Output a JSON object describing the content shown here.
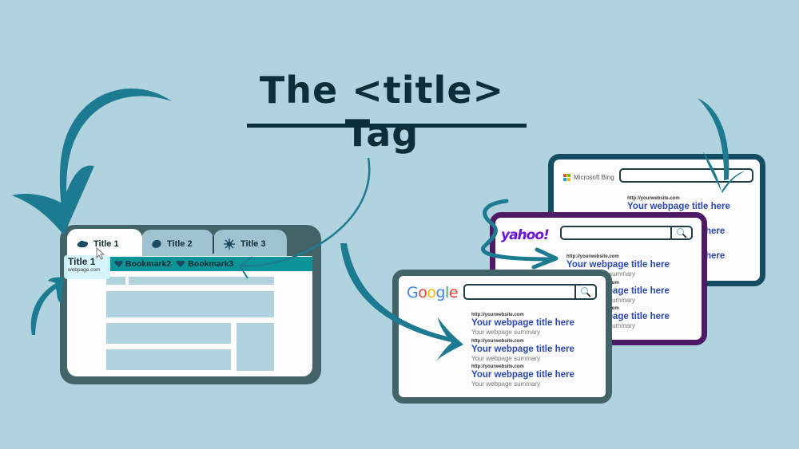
{
  "header": {
    "title": "The <title> Tag"
  },
  "browser": {
    "tabs": [
      {
        "label": "Title 1",
        "icon": "blob-icon",
        "active": true
      },
      {
        "label": "Title 2",
        "icon": "blob-icon",
        "active": false
      },
      {
        "label": "Title 3",
        "icon": "splat-icon",
        "active": false
      }
    ],
    "tooltip": {
      "title": "Title 1",
      "url": "webpage.com"
    },
    "bookmarks": [
      {
        "label": "Bookmark2",
        "icon": "heart-icon"
      },
      {
        "label": "Bookmark3",
        "icon": "heart-icon"
      }
    ]
  },
  "search_engines": {
    "bing": {
      "name": "Microsoft Bing",
      "border_color": "#144c62",
      "results": [
        {
          "url": "http://yourwebsite.com",
          "title": "Your webpage title here"
        },
        {
          "title_fragment": "here"
        },
        {
          "title_fragment": "here"
        }
      ]
    },
    "yahoo": {
      "name": "yahoo!",
      "border_color": "#4e1a66",
      "results": [
        {
          "url": "http://yourwebsite.com",
          "title": "Your webpage title here",
          "summary": "Your webpage summary"
        },
        {
          "url": "http://yourwebsite.com",
          "title": "Your webpage title here",
          "summary": "Your webpage summary"
        },
        {
          "url": "http://yourwebsite.com",
          "title": "Your webpage title here",
          "summary": "Your webpage summary"
        }
      ]
    },
    "google": {
      "name": "Google",
      "border_color": "#426468",
      "results": [
        {
          "url": "http://yourwebsite.com",
          "title": "Your webpage title here",
          "summary": "Your webpage summary"
        },
        {
          "url": "http://yourwebsite.com",
          "title": "Your webpage title here",
          "summary": "Your webpage summary"
        },
        {
          "url": "http://yourwebsite.com",
          "title": "Your webpage title here",
          "summary": "Your webpage summary"
        }
      ]
    }
  },
  "colors": {
    "background": "#b1d3df",
    "arrow": "#1d7b91",
    "title_text": "#0a2e3b",
    "result_title": "#2c47b0",
    "bookmark_bar": "#0c9498"
  }
}
